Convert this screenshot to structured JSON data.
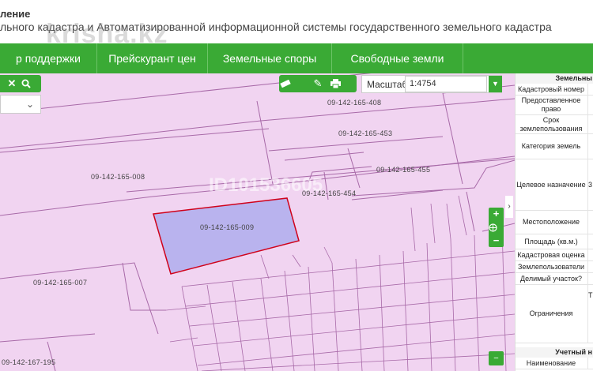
{
  "header": {
    "line1": "ление",
    "line2": "льного кадастра и Автоматизированной информационной системы государственного земельного кадастра",
    "watermark": "krisha.kz"
  },
  "nav": [
    {
      "label": "р поддержки"
    },
    {
      "label": "Прейскурант цен"
    },
    {
      "label": "Земельные споры"
    },
    {
      "label": "Свободные земли"
    }
  ],
  "map": {
    "watermark": "ID101536605",
    "scale": {
      "label": "Масштаб",
      "value": "1:4754"
    },
    "plots": [
      {
        "label": "09-142-165-408"
      },
      {
        "label": "09-142-165-453"
      },
      {
        "label": "09-142-165-008"
      },
      {
        "label": "09-142-165-455"
      },
      {
        "label": "09-142-165-454"
      },
      {
        "label": "09-142-165-009"
      },
      {
        "label": "09-142-165-007"
      },
      {
        "label": "09-142-167-195"
      }
    ],
    "icons": {
      "close": "close-icon",
      "search": "search-icon",
      "ruler": "ruler-icon",
      "pencil": "pencil-icon",
      "print": "print-icon",
      "zoom_in": "plus-icon",
      "locate": "globe-icon",
      "zoom_out": "minus-icon",
      "collapse": "chevron-right-icon",
      "dropdown": "chevron-down-icon"
    }
  },
  "panel": {
    "title": "Земельны",
    "rows": [
      {
        "label": "Кадастровый номер",
        "value": ""
      },
      {
        "label": "Предоставленное право",
        "value": ""
      },
      {
        "label": "Срок землепользования",
        "value": ""
      },
      {
        "label": "Категория земель",
        "value": ""
      },
      {
        "label": "Целевое назначение",
        "value": "3"
      },
      {
        "label": "Местоположение",
        "value": ""
      },
      {
        "label": "Площадь (кв.м.)",
        "value": ""
      },
      {
        "label": "Кадастровая оценка",
        "value": ""
      },
      {
        "label": "Землепользователи",
        "value": ""
      },
      {
        "label": "Делимый участок?",
        "value": ""
      },
      {
        "label": "Ограничения",
        "value": "Т"
      }
    ],
    "title2": "Учетный н",
    "row_last": "Наименование"
  },
  "colors": {
    "accent": "#3aaa35",
    "map_bg": "#f1d4f1",
    "selected_plot": "#b9b3ee",
    "selected_border": "#d0021b"
  }
}
